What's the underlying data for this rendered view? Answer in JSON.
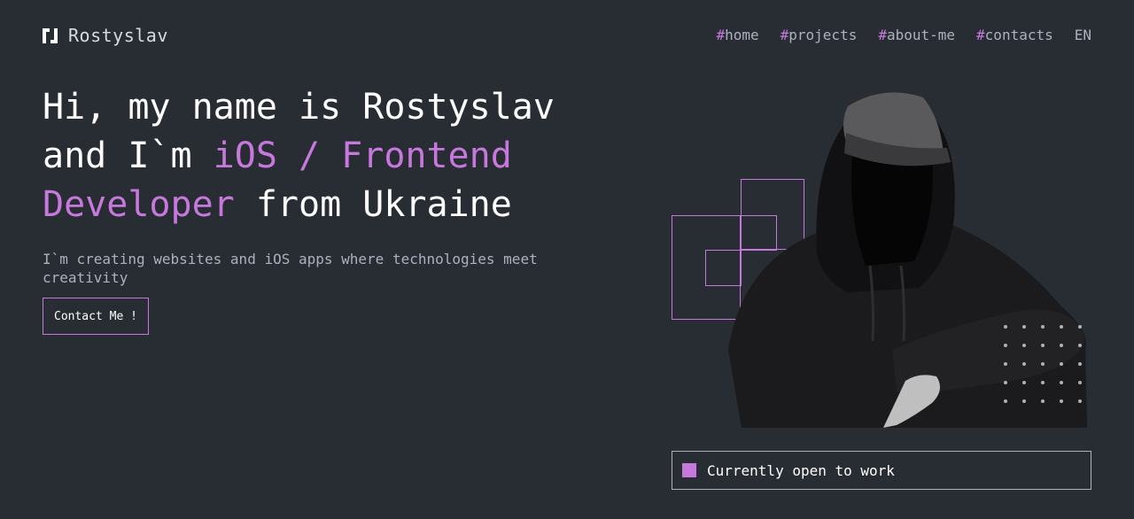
{
  "header": {
    "logo_text": "Rostyslav",
    "nav": [
      {
        "hash": "#",
        "label": "home"
      },
      {
        "hash": "#",
        "label": "projects"
      },
      {
        "hash": "#",
        "label": "about-me"
      },
      {
        "hash": "#",
        "label": "contacts"
      }
    ],
    "lang": "EN"
  },
  "hero": {
    "line1": "Hi, my name is Rostyslav",
    "line2_prefix": "and I`m ",
    "line2_accent": "iOS / Frontend",
    "line3_accent": "Developer",
    "line3_suffix": " from Ukraine",
    "subtitle": "I`m creating websites and iOS apps where technologies meet creativity",
    "button_label": "Contact Me !"
  },
  "status": {
    "text": "Currently open to work"
  },
  "colors": {
    "background": "#282c33",
    "accent": "#c778dd",
    "gray": "#abb2bf",
    "white": "#ffffff"
  },
  "icons": {
    "logo": "logo-icon"
  }
}
